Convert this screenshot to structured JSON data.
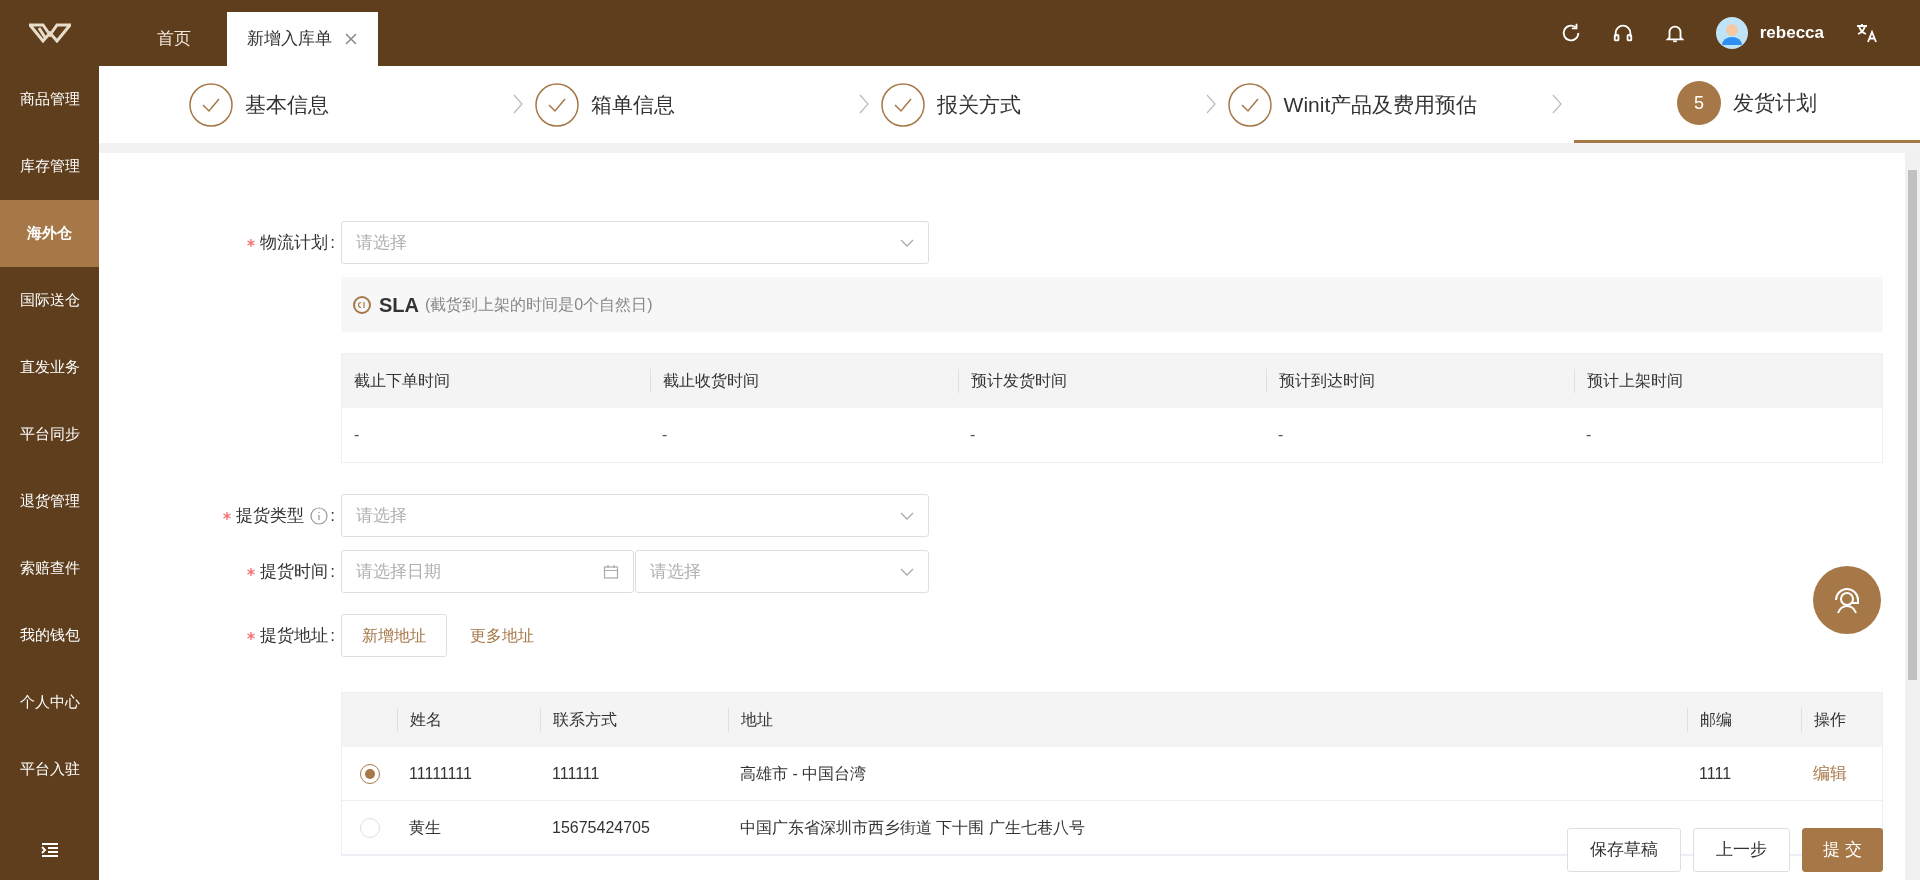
{
  "header": {
    "tabs": [
      {
        "label": "首页",
        "selected": false,
        "closable": false
      },
      {
        "label": "新增入库单",
        "selected": true,
        "closable": true
      }
    ],
    "user": {
      "name": "rebecca"
    }
  },
  "sidebar": {
    "items": [
      {
        "label": "商品管理",
        "selected": false
      },
      {
        "label": "库存管理",
        "selected": false
      },
      {
        "label": "海外仓",
        "selected": true
      },
      {
        "label": "国际送仓",
        "selected": false
      },
      {
        "label": "直发业务",
        "selected": false
      },
      {
        "label": "平台同步",
        "selected": false
      },
      {
        "label": "退货管理",
        "selected": false
      },
      {
        "label": "索赔查件",
        "selected": false
      },
      {
        "label": "我的钱包",
        "selected": false
      },
      {
        "label": "个人中心",
        "selected": false
      },
      {
        "label": "平台入驻",
        "selected": false
      }
    ]
  },
  "steps": [
    {
      "label": "基本信息",
      "done": true,
      "selected": false
    },
    {
      "label": "箱单信息",
      "done": true,
      "selected": false
    },
    {
      "label": "报关方式",
      "done": true,
      "selected": false
    },
    {
      "label": "Winit产品及费用预估",
      "done": true,
      "selected": false
    },
    {
      "label": "发货计划",
      "done": false,
      "selected": true,
      "number": "5"
    }
  ],
  "form": {
    "logistics_plan": {
      "label": "物流计划",
      "colon": ":",
      "required": true,
      "placeholder": "请选择"
    },
    "sla": {
      "title": "SLA",
      "note": "(截货到上架的时间是0个自然日)"
    },
    "sla_table": {
      "columns": [
        "截止下单时间",
        "截止收货时间",
        "预计发货时间",
        "预计到达时间",
        "预计上架时间"
      ],
      "rows": [
        [
          "-",
          "-",
          "-",
          "-",
          "-"
        ]
      ]
    },
    "pickup_type": {
      "label": "提货类型",
      "colon": ":",
      "required": true,
      "placeholder": "请选择"
    },
    "pickup_time": {
      "label": "提货时间",
      "colon": ":",
      "required": true,
      "date_placeholder": "请选择日期",
      "placeholder": "请选择"
    },
    "pickup_address": {
      "label": "提货地址",
      "colon": ":",
      "required": true,
      "add_button": "新增地址",
      "more_link": "更多地址"
    },
    "address_table": {
      "columns": [
        "姓名",
        "联系方式",
        "地址",
        "邮编",
        "操作"
      ],
      "rows": [
        {
          "selected": true,
          "name": "11111111",
          "phone": "111111",
          "address": "高雄市 - 中国台湾",
          "postcode": "1111",
          "action": "编辑"
        },
        {
          "selected": false,
          "name": "黄生",
          "phone": "15675424705",
          "address": "中国广东省深圳市西乡街道 下十围 广生七巷八号"
        }
      ]
    }
  },
  "footer_buttons": [
    {
      "label": "保存草稿",
      "kind": "default"
    },
    {
      "label": "上一步",
      "kind": "default"
    },
    {
      "label": "提 交",
      "kind": "primary"
    }
  ]
}
